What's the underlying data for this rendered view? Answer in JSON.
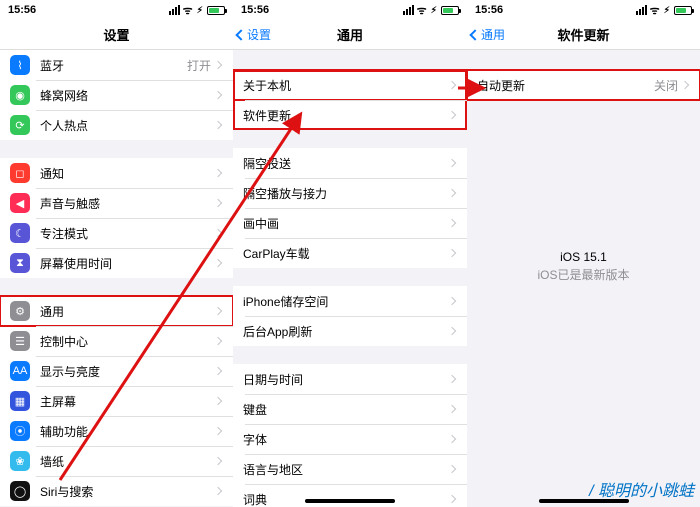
{
  "status": {
    "time": "15:56",
    "signal_glyph": ".ıll",
    "wifi_glyph": "▾"
  },
  "p1": {
    "title": "设置",
    "g1": [
      {
        "name": "bluetooth",
        "color": "#0a7aff",
        "glyph": "⌇",
        "label": "蓝牙",
        "value": "打开"
      },
      {
        "name": "cellular",
        "color": "#34c759",
        "glyph": "◉",
        "label": "蜂窝网络"
      },
      {
        "name": "hotspot",
        "color": "#34c759",
        "glyph": "⟳",
        "label": "个人热点"
      }
    ],
    "g2": [
      {
        "name": "notifications",
        "color": "#ff3b30",
        "glyph": "◻",
        "label": "通知"
      },
      {
        "name": "sounds",
        "color": "#ff2d55",
        "glyph": "◀︎",
        "label": "声音与触感"
      },
      {
        "name": "focus",
        "color": "#5856d6",
        "glyph": "☾",
        "label": "专注模式"
      },
      {
        "name": "screentime",
        "color": "#5856d6",
        "glyph": "⧗",
        "label": "屏幕使用时间"
      }
    ],
    "g3": [
      {
        "name": "general",
        "color": "#8e8e93",
        "glyph": "⚙︎",
        "label": "通用",
        "hl": true
      },
      {
        "name": "control-center",
        "color": "#8e8e93",
        "glyph": "☰",
        "label": "控制中心"
      },
      {
        "name": "display",
        "color": "#0a7aff",
        "glyph": "AA",
        "label": "显示与亮度"
      },
      {
        "name": "home-screen",
        "color": "#3355dd",
        "glyph": "▦",
        "label": "主屏幕"
      },
      {
        "name": "accessibility",
        "color": "#0a7aff",
        "glyph": "⦿",
        "label": "辅助功能"
      },
      {
        "name": "wallpaper",
        "color": "#33bbee",
        "glyph": "❀",
        "label": "墙纸"
      },
      {
        "name": "siri",
        "color": "#111",
        "glyph": "◯",
        "label": "Siri与搜索"
      }
    ]
  },
  "p2": {
    "back": "设置",
    "title": "通用",
    "g1": [
      {
        "name": "about",
        "label": "关于本机",
        "hl": true
      },
      {
        "name": "software-update",
        "label": "软件更新"
      }
    ],
    "g2": [
      {
        "name": "airdrop",
        "label": "隔空投送"
      },
      {
        "name": "airplay",
        "label": "隔空播放与接力"
      },
      {
        "name": "pip",
        "label": "画中画"
      },
      {
        "name": "carplay",
        "label": "CarPlay车载"
      }
    ],
    "g3": [
      {
        "name": "iphone-storage",
        "label": "iPhone储存空间"
      },
      {
        "name": "background-refresh",
        "label": "后台App刷新"
      }
    ],
    "g4": [
      {
        "name": "date-time",
        "label": "日期与时间"
      },
      {
        "name": "keyboard",
        "label": "键盘"
      },
      {
        "name": "fonts",
        "label": "字体"
      },
      {
        "name": "language-region",
        "label": "语言与地区"
      },
      {
        "name": "dictionary",
        "label": "词典"
      }
    ]
  },
  "p3": {
    "back": "通用",
    "title": "软件更新",
    "row": {
      "name": "auto-update",
      "label": "自动更新",
      "value": "关闭",
      "hl": true
    },
    "msg1": "iOS 15.1",
    "msg2": "iOS已是最新版本"
  },
  "watermark": "/ 聪明的小跳蛙"
}
